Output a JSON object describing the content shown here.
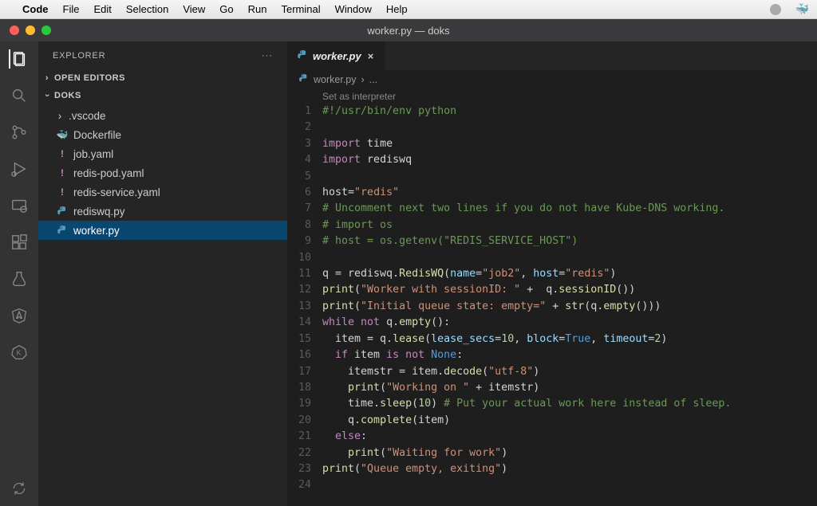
{
  "menubar": {
    "app_name": "Code",
    "items": [
      "File",
      "Edit",
      "Selection",
      "View",
      "Go",
      "Run",
      "Terminal",
      "Window",
      "Help"
    ]
  },
  "window": {
    "title": "worker.py — doks"
  },
  "sidebar": {
    "title": "EXPLORER",
    "open_editors_label": "OPEN EDITORS",
    "workspace_label": "DOKS",
    "tree": [
      {
        "kind": "folder",
        "name": ".vscode",
        "icon": "chevron-right"
      },
      {
        "kind": "file",
        "name": "Dockerfile",
        "icon": "docker",
        "color": "#519aba"
      },
      {
        "kind": "file",
        "name": "job.yaml",
        "icon": "yaml",
        "color": "#c586c0"
      },
      {
        "kind": "file",
        "name": "redis-pod.yaml",
        "icon": "yaml",
        "color": "#c586c0"
      },
      {
        "kind": "file",
        "name": "redis-service.yaml",
        "icon": "yaml",
        "color": "#c586c0"
      },
      {
        "kind": "file",
        "name": "rediswq.py",
        "icon": "python",
        "color": "#519aba"
      },
      {
        "kind": "file",
        "name": "worker.py",
        "icon": "python",
        "color": "#519aba",
        "selected": true
      }
    ]
  },
  "tab": {
    "label": "worker.py"
  },
  "breadcrumb": {
    "file": "worker.py",
    "sep": "›",
    "tail": "..."
  },
  "codelens": {
    "label": "Set as interpreter"
  },
  "code": {
    "lines": [
      {
        "n": 1,
        "t": [
          [
            "cmt",
            "#!/usr/bin/env python"
          ]
        ]
      },
      {
        "n": 2,
        "t": []
      },
      {
        "n": 3,
        "t": [
          [
            "kw",
            "import"
          ],
          [
            "var",
            " time"
          ]
        ]
      },
      {
        "n": 4,
        "t": [
          [
            "kw",
            "import"
          ],
          [
            "var",
            " rediswq"
          ]
        ]
      },
      {
        "n": 5,
        "t": []
      },
      {
        "n": 6,
        "t": [
          [
            "var",
            "host"
          ],
          [
            "var",
            "="
          ],
          [
            "str",
            "\"redis\""
          ]
        ]
      },
      {
        "n": 7,
        "t": [
          [
            "cmt",
            "# Uncomment next two lines if you do not have Kube-DNS working."
          ]
        ]
      },
      {
        "n": 8,
        "t": [
          [
            "cmt",
            "# import os"
          ]
        ]
      },
      {
        "n": 9,
        "t": [
          [
            "cmt",
            "# host = os.getenv(\"REDIS_SERVICE_HOST\")"
          ]
        ]
      },
      {
        "n": 10,
        "t": []
      },
      {
        "n": 11,
        "t": [
          [
            "var",
            "q = rediswq."
          ],
          [
            "fn",
            "RedisWQ"
          ],
          [
            "var",
            "("
          ],
          [
            "param",
            "name"
          ],
          [
            "var",
            "="
          ],
          [
            "str",
            "\"job2\""
          ],
          [
            "var",
            ", "
          ],
          [
            "param",
            "host"
          ],
          [
            "var",
            "="
          ],
          [
            "str",
            "\"redis\""
          ],
          [
            "var",
            ")"
          ]
        ]
      },
      {
        "n": 12,
        "t": [
          [
            "fn",
            "print"
          ],
          [
            "var",
            "("
          ],
          [
            "str",
            "\"Worker with sessionID: \""
          ],
          [
            "var",
            " +  q."
          ],
          [
            "fn",
            "sessionID"
          ],
          [
            "var",
            "())"
          ]
        ]
      },
      {
        "n": 13,
        "t": [
          [
            "fn",
            "print"
          ],
          [
            "var",
            "("
          ],
          [
            "str",
            "\"Initial queue state: empty=\""
          ],
          [
            "var",
            " + "
          ],
          [
            "fn",
            "str"
          ],
          [
            "var",
            "(q."
          ],
          [
            "fn",
            "empty"
          ],
          [
            "var",
            "()))"
          ]
        ]
      },
      {
        "n": 14,
        "t": [
          [
            "kw",
            "while"
          ],
          [
            "var",
            " "
          ],
          [
            "kw",
            "not"
          ],
          [
            "var",
            " q."
          ],
          [
            "fn",
            "empty"
          ],
          [
            "var",
            "():"
          ]
        ]
      },
      {
        "n": 15,
        "t": [
          [
            "var",
            "  item = q."
          ],
          [
            "fn",
            "lease"
          ],
          [
            "var",
            "("
          ],
          [
            "param",
            "lease_secs"
          ],
          [
            "var",
            "="
          ],
          [
            "num",
            "10"
          ],
          [
            "var",
            ", "
          ],
          [
            "param",
            "block"
          ],
          [
            "var",
            "="
          ],
          [
            "bool",
            "True"
          ],
          [
            "var",
            ", "
          ],
          [
            "param",
            "timeout"
          ],
          [
            "var",
            "="
          ],
          [
            "num",
            "2"
          ],
          [
            "var",
            ")"
          ]
        ]
      },
      {
        "n": 16,
        "t": [
          [
            "var",
            "  "
          ],
          [
            "kw",
            "if"
          ],
          [
            "var",
            " item "
          ],
          [
            "kw",
            "is"
          ],
          [
            "var",
            " "
          ],
          [
            "kw",
            "not"
          ],
          [
            "var",
            " "
          ],
          [
            "bool",
            "None"
          ],
          [
            "var",
            ":"
          ]
        ]
      },
      {
        "n": 17,
        "t": [
          [
            "var",
            "    itemstr = item."
          ],
          [
            "fn",
            "decode"
          ],
          [
            "var",
            "("
          ],
          [
            "str",
            "\"utf-8\""
          ],
          [
            "var",
            ")"
          ]
        ]
      },
      {
        "n": 18,
        "t": [
          [
            "var",
            "    "
          ],
          [
            "fn",
            "print"
          ],
          [
            "var",
            "("
          ],
          [
            "str",
            "\"Working on \""
          ],
          [
            "var",
            " + itemstr)"
          ]
        ]
      },
      {
        "n": 19,
        "t": [
          [
            "var",
            "    time."
          ],
          [
            "fn",
            "sleep"
          ],
          [
            "var",
            "("
          ],
          [
            "num",
            "10"
          ],
          [
            "var",
            ") "
          ],
          [
            "cmt",
            "# Put your actual work here instead of sleep."
          ]
        ]
      },
      {
        "n": 20,
        "t": [
          [
            "var",
            "    q."
          ],
          [
            "fn",
            "complete"
          ],
          [
            "var",
            "(item)"
          ]
        ]
      },
      {
        "n": 21,
        "t": [
          [
            "var",
            "  "
          ],
          [
            "kw",
            "else"
          ],
          [
            "var",
            ":"
          ]
        ]
      },
      {
        "n": 22,
        "t": [
          [
            "var",
            "    "
          ],
          [
            "fn",
            "print"
          ],
          [
            "var",
            "("
          ],
          [
            "str",
            "\"Waiting for work\""
          ],
          [
            "var",
            ")"
          ]
        ]
      },
      {
        "n": 23,
        "t": [
          [
            "fn",
            "print"
          ],
          [
            "var",
            "("
          ],
          [
            "str",
            "\"Queue empty, exiting\""
          ],
          [
            "var",
            ")"
          ]
        ]
      },
      {
        "n": 24,
        "t": []
      }
    ]
  }
}
